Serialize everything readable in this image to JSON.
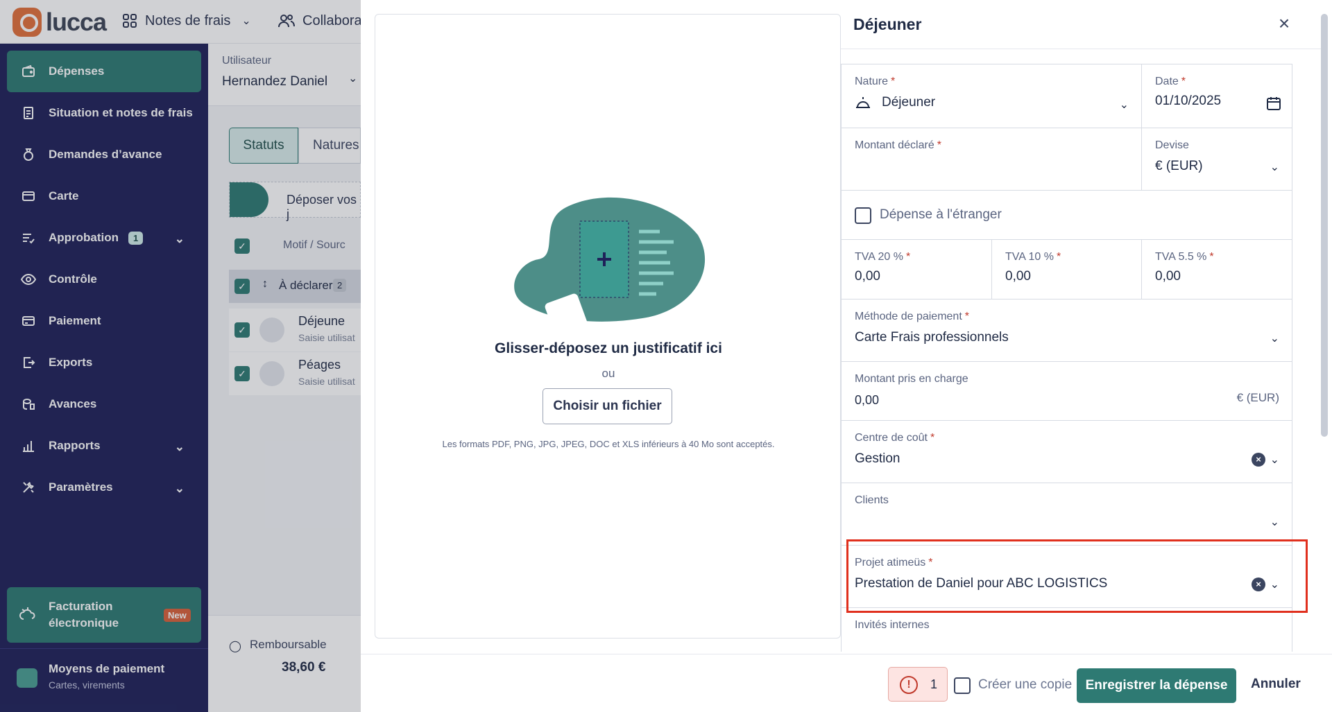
{
  "topbar": {
    "logo_text": "lucca",
    "app_menu_label": "Notes de frais",
    "collab_label": "Collabora"
  },
  "sidebar": {
    "items": [
      {
        "label": "Dépenses",
        "icon": "wallet-icon"
      },
      {
        "label": "Situation et notes de frais",
        "icon": "receipt-icon"
      },
      {
        "label": "Demandes d’avance",
        "icon": "moneybag-icon"
      },
      {
        "label": "Carte",
        "icon": "card-icon"
      },
      {
        "label": "Approbation",
        "icon": "checklist-icon",
        "badge": "1"
      },
      {
        "label": "Contrôle",
        "icon": "eye-icon"
      },
      {
        "label": "Paiement",
        "icon": "payment-card-icon"
      },
      {
        "label": "Exports",
        "icon": "export-icon"
      },
      {
        "label": "Avances",
        "icon": "coins-icon"
      },
      {
        "label": "Rapports",
        "icon": "bar-chart-icon"
      },
      {
        "label": "Paramètres",
        "icon": "tools-icon"
      }
    ],
    "facturation": {
      "line1": "Facturation",
      "line2": "électronique",
      "badge": "New"
    },
    "moyens": {
      "title": "Moyens de paiement",
      "subtitle": "Cartes, virements"
    }
  },
  "background": {
    "user_label": "Utilisateur",
    "user_value": "Hernandez Daniel",
    "tabs": [
      "Statuts",
      "Natures"
    ],
    "deposit_text": "Déposer vos j",
    "column_motif": "Motif / Sourc",
    "group_label": "À déclarer",
    "group_count": "2",
    "rows": [
      {
        "title": "Déjeune",
        "sub": "Saisie utilisat"
      },
      {
        "title": "Péages",
        "sub": "Saisie utilisat"
      }
    ],
    "remboursable_label": "Remboursable",
    "remboursable_amount": "38,60 €"
  },
  "dropzone": {
    "title": "Glisser-déposez un justificatif ici",
    "or": "ou",
    "button": "Choisir un fichier",
    "note": "Les formats PDF, PNG, JPG, JPEG, DOC et XLS inférieurs à 40 Mo sont acceptés."
  },
  "form": {
    "title": "Déjeuner",
    "nature_label": "Nature",
    "nature_value": "Déjeuner",
    "date_label": "Date",
    "date_value": "01/10/2025",
    "montant_label": "Montant déclaré",
    "devise_label": "Devise",
    "devise_value": "€ (EUR)",
    "etranger_label": "Dépense à l'étranger",
    "tva20_label": "TVA 20 %",
    "tva20_value": "0,00",
    "tva10_label": "TVA 10 %",
    "tva10_value": "0,00",
    "tva55_label": "TVA 5.5 %",
    "tva55_value": "0,00",
    "methode_label": "Méthode de paiement",
    "methode_value": "Carte Frais professionnels",
    "pris_label": "Montant pris en charge",
    "pris_value": "0,00",
    "pris_currency": "€ (EUR)",
    "centre_label": "Centre de coût",
    "centre_value": "Gestion",
    "clients_label": "Clients",
    "projet_label": "Projet atimeüs",
    "projet_value": "Prestation de Daniel pour ABC LOGISTICS",
    "invites_label": "Invités internes",
    "required_mark": "*"
  },
  "footer": {
    "warning_count": "1",
    "copy_label": "Créer une copie",
    "save_label": "Enregistrer la dépense",
    "cancel_label": "Annuler"
  },
  "colors": {
    "sidebar": "#1f2159",
    "accent": "#2e7a73",
    "highlight": "#e0301e"
  }
}
